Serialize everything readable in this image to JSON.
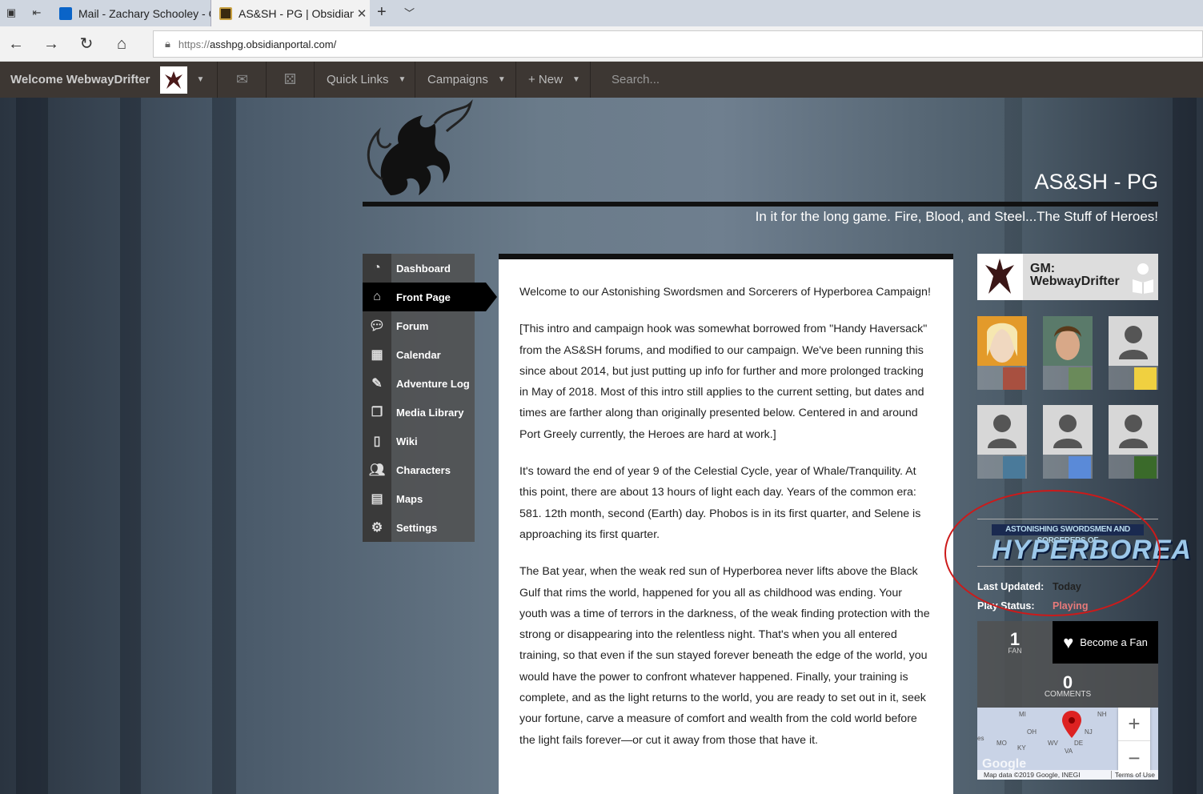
{
  "browser": {
    "tabs": [
      {
        "title": "Mail - Zachary Schooley - O",
        "active": false
      },
      {
        "title": "AS&SH - PG | Obsidian",
        "active": true
      }
    ],
    "url_proto": "https://",
    "url_host": "asshpg.obsidianportal.com/"
  },
  "topnav": {
    "welcome": "Welcome WebwayDrifter",
    "quick_links": "Quick Links",
    "campaigns": "Campaigns",
    "new": "+ New",
    "search_placeholder": "Search..."
  },
  "header": {
    "title": "AS&SH - PG",
    "tagline": "In it for the long game. Fire, Blood, and Steel...The Stuff of Heroes!"
  },
  "sidebar": {
    "items": [
      {
        "label": "Dashboard",
        "icon": "dashboard-icon"
      },
      {
        "label": "Front Page",
        "icon": "home-icon",
        "active": true
      },
      {
        "label": "Forum",
        "icon": "forum-icon"
      },
      {
        "label": "Calendar",
        "icon": "calendar-icon"
      },
      {
        "label": "Adventure Log",
        "icon": "adventure-log-icon"
      },
      {
        "label": "Media Library",
        "icon": "media-library-icon"
      },
      {
        "label": "Wiki",
        "icon": "wiki-icon"
      },
      {
        "label": "Characters",
        "icon": "characters-icon"
      },
      {
        "label": "Maps",
        "icon": "maps-icon"
      },
      {
        "label": "Settings",
        "icon": "settings-icon"
      }
    ]
  },
  "content": {
    "paragraphs": [
      "Welcome to our Astonishing  Swordsmen and Sorcerers of Hyperborea Campaign!",
      "[This intro and campaign hook was somewhat borrowed from \"Handy Haversack\" from the AS&SH forums, and modified to our campaign.  We've been running this since about 2014, but just putting up info for further and more prolonged tracking in May of 2018.  Most of this intro still applies to the current setting, but dates and times are farther along than originally presented below.  Centered in and around Port Greely currently, the Heroes are hard at work.]",
      "It's toward the end of year 9 of the Celestial Cycle, year of Whale/Tranquility.  At this point, there are about 13 hours of light each day. Years of the common era: 581. 12th month, second (Earth) day.  Phobos is in its first quarter, and Selene is approaching its first quarter.",
      "The Bat year, when the weak red sun of Hyperborea never lifts above the Black Gulf that rims the world, happened for you all as childhood was ending. Your youth was a time of terrors in the darkness, of the weak finding protection with the strong or disappearing into the relentless night. That's when you all entered training, so that even if the sun stayed forever beneath the edge of the world, you would have the power to confront whatever happened. Finally, your training is complete, and as the light returns to the world, you are ready to set out in it, seek your fortune, carve a measure of comfort and wealth from the cold world before the light fails forever—or cut it away from those that have it."
    ]
  },
  "gm": {
    "label": "GM:",
    "name": "WebwayDrifter"
  },
  "game_logo": {
    "line1": "ASTONISHING SWORDSMEN AND SORCERERS OF",
    "line2": "HYPERBOREA"
  },
  "meta": {
    "last_updated_label": "Last Updated:",
    "last_updated_value": "Today",
    "play_status_label": "Play Status:",
    "play_status_value": "Playing"
  },
  "fans": {
    "count": "1",
    "label": "FAN",
    "button": "Become a Fan",
    "comments_count": "0",
    "comments_label": "COMMENTS"
  },
  "map": {
    "attribution": "Map data ©2019 Google, INEGI",
    "terms": "Terms of Use",
    "zoom_in": "+",
    "zoom_out": "−",
    "labels": [
      "MI",
      "NH",
      "OH",
      "NJ",
      "KY",
      "WV",
      "VA",
      "DE",
      "MO",
      "es"
    ],
    "google_mark": "Google"
  },
  "colors": {
    "nav_bg": "#3d3733",
    "play_status": "#e87a7a",
    "annotation": "#cc1a1a"
  }
}
